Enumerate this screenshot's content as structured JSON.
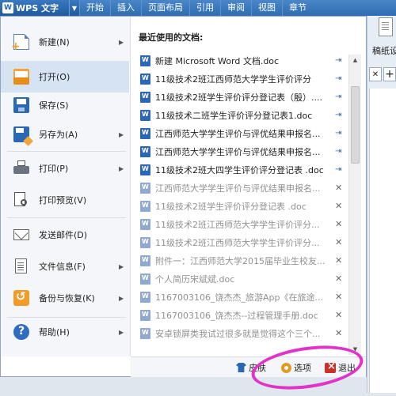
{
  "app": {
    "logo_text": "W",
    "title": "WPS 文字",
    "dropdown_arrow": "▼"
  },
  "ribbon": {
    "tabs": [
      "开始",
      "插入",
      "页面布局",
      "引用",
      "审阅",
      "视图",
      "章节"
    ]
  },
  "right_area": {
    "draft_label": "稿纸设",
    "tab_close": "✕",
    "tab_add": "+"
  },
  "menu": {
    "items": [
      {
        "label": "新建(N)",
        "icon": "new-document-icon",
        "has_submenu": true
      },
      {
        "label": "打开(O)",
        "icon": "open-folder-icon",
        "has_submenu": false,
        "active": true
      },
      {
        "label": "保存(S)",
        "icon": "save-icon",
        "has_submenu": false
      },
      {
        "label": "另存为(A)",
        "icon": "save-as-icon",
        "has_submenu": true
      },
      {
        "label": "打印(P)",
        "icon": "printer-icon",
        "has_submenu": true
      },
      {
        "label": "打印预览(V)",
        "icon": "print-preview-icon",
        "has_submenu": false
      },
      {
        "label": "发送邮件(D)",
        "icon": "mail-icon",
        "has_submenu": false
      },
      {
        "label": "文件信息(F)",
        "icon": "file-info-icon",
        "has_submenu": true
      },
      {
        "label": "备份与恢复(K)",
        "icon": "backup-restore-icon",
        "has_submenu": true
      },
      {
        "label": "帮助(H)",
        "icon": "help-icon",
        "has_submenu": true
      }
    ],
    "submenu_arrow": "▶"
  },
  "recent": {
    "title": "最近使用的文档:",
    "items": [
      {
        "name": "新建 Microsoft Word 文档.doc",
        "pinned": true
      },
      {
        "name": "11级技术2班江西师范大学学生评价评分",
        "pinned": true
      },
      {
        "name": "11级技术2班学生评价评分登记表（殷）....",
        "pinned": true
      },
      {
        "name": "11级技术二班学生评价评分登记表1.doc",
        "pinned": true
      },
      {
        "name": "江西师范大学学生评价与评优结果申报名...",
        "pinned": true
      },
      {
        "name": "江西师范大学学生评价与评优结果申报名...",
        "pinned": true
      },
      {
        "name": "11级技术2班大四学生评价评分登记表 .doc",
        "pinned": true
      },
      {
        "name": "江西师范大学学生评价与评优结果申报名...",
        "pinned": false
      },
      {
        "name": "11级技术2班学生评价评分登记表 .doc",
        "pinned": false
      },
      {
        "name": "11级技术2班江西师范大学学生评价评分...",
        "pinned": false
      },
      {
        "name": "11级技术2班江西师范大学学生评价评分...",
        "pinned": false
      },
      {
        "name": "附件一：江西师范大学2015届毕业生校友...",
        "pinned": false
      },
      {
        "name": "个人简历宋斌斌.doc",
        "pinned": false
      },
      {
        "name": "1167003106_饶杰杰_旅游App《在旅途...",
        "pinned": false
      },
      {
        "name": "1167003106_饶杰杰--过程管理手册.doc",
        "pinned": false
      },
      {
        "name": "安卓锁屏类我试过很多就是觉得这个三个...",
        "pinned": false
      }
    ],
    "pin_on": "⇥",
    "pin_off": "✕"
  },
  "scrollbar": {
    "up_arrow": "▲",
    "down_arrow": "▼"
  },
  "bottom": {
    "skin_label": "皮肤",
    "options_label": "选项",
    "exit_label": "退出"
  },
  "annotation": {
    "color": "#e233c8"
  }
}
